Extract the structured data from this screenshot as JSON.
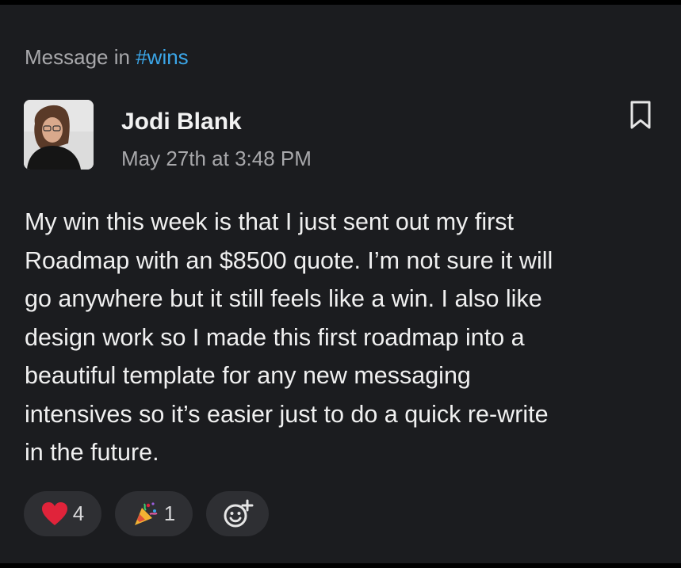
{
  "context": {
    "prefix": "Message in",
    "channel": "#wins"
  },
  "message": {
    "author": "Jodi Blank",
    "timestamp": "May 27th at 3:48 PM",
    "lines": [
      "My win this week is that I just sent out my first",
      "Roadmap with an $8500 quote. I’m not sure it will",
      "go anywhere but it still feels like a win. I also like",
      "design work so I made this first roadmap into a",
      "beautiful template for any new messaging",
      "intensives so it’s easier just to do a quick re-write",
      "in the future."
    ]
  },
  "reactions": [
    {
      "icon": "heart-icon",
      "count": "4"
    },
    {
      "icon": "party-popper-icon",
      "count": "1"
    },
    {
      "icon": "add-reaction-icon"
    }
  ],
  "colors": {
    "background": "#1b1c1f",
    "channel_link": "#3ba6e8",
    "reaction_bg": "#2e2f33",
    "heart": "#e0233a"
  }
}
